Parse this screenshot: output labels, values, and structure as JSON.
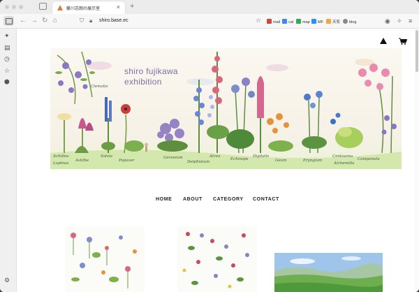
{
  "browser": {
    "tab_title": "藤川志朗の展示室",
    "url": "shiro.base.ec",
    "bookmarks": [
      {
        "label": "mail",
        "color": "#d44638"
      },
      {
        "label": "cal",
        "color": "#4285f4"
      },
      {
        "label": "map",
        "color": "#34a853"
      },
      {
        "label": "MF",
        "color": "#2d8cff"
      },
      {
        "label": "天気",
        "color": "#f2a93b"
      },
      {
        "label": "blog",
        "color": "#888888"
      }
    ]
  },
  "site": {
    "title_line1": "shiro fujikawa",
    "title_line2": "exhibition",
    "nav": [
      "HOME",
      "ABOUT",
      "CATEGORY",
      "CONTACT"
    ]
  },
  "banner_labels": [
    "Clematis",
    "Achillea",
    "Astilbe",
    "Salvia",
    "Papaver",
    "Geranium",
    "Delphinium",
    "Alcea",
    "Echinops",
    "Digitalis",
    "Geum",
    "Eryngium",
    "Centaurea",
    "Alchemilla",
    "Campanula",
    "Lupinus"
  ],
  "colors": {
    "title": "#7d6fa3",
    "label": "#3f5a3a"
  }
}
